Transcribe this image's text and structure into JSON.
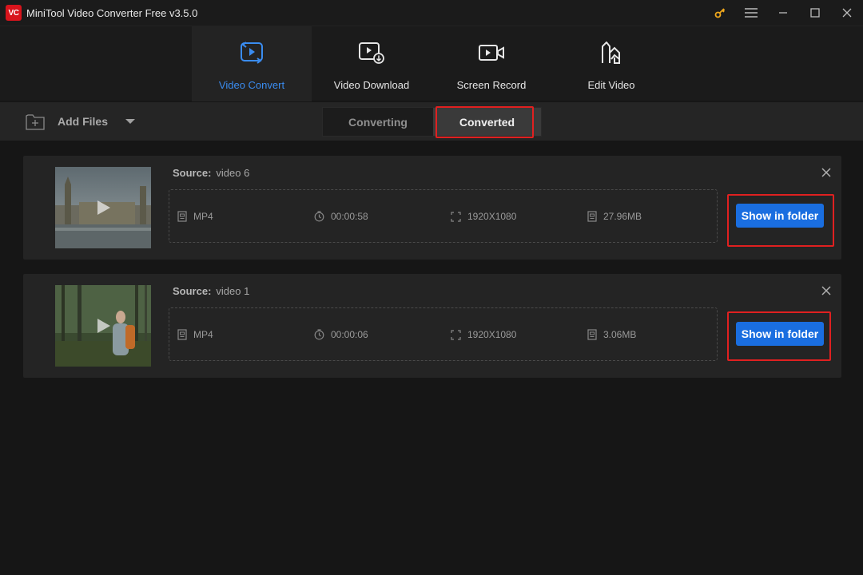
{
  "app": {
    "logo_text": "VC",
    "title": "MiniTool Video Converter Free v3.5.0",
    "accent_color": "#3a8cf0",
    "brand_color": "#d8141c"
  },
  "nav": {
    "tabs": [
      {
        "label": "Video Convert",
        "icon": "video-convert-icon",
        "active": true
      },
      {
        "label": "Video Download",
        "icon": "video-download-icon",
        "active": false
      },
      {
        "label": "Screen Record",
        "icon": "screen-record-icon",
        "active": false
      },
      {
        "label": "Edit Video",
        "icon": "edit-video-icon",
        "active": false
      }
    ]
  },
  "toolbar": {
    "add_files_label": "Add Files",
    "segments": {
      "converting": "Converting",
      "converted": "Converted",
      "selected": "Converted"
    }
  },
  "files": [
    {
      "source_label": "Source:",
      "name": "video 6",
      "format": "MP4",
      "duration": "00:00:58",
      "resolution": "1920X1080",
      "size": "27.96MB",
      "action_label": "Show in folder"
    },
    {
      "source_label": "Source:",
      "name": "video 1",
      "format": "MP4",
      "duration": "00:00:06",
      "resolution": "1920X1080",
      "size": "3.06MB",
      "action_label": "Show in folder"
    }
  ]
}
